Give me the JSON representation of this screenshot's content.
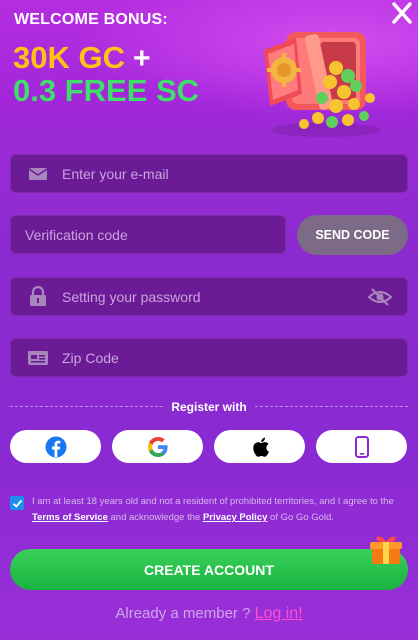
{
  "banner": {
    "welcome": "WELCOME BONUS:",
    "gc": "30K GC",
    "plus": "+",
    "sc": "0.3 FREE SC"
  },
  "form": {
    "email_placeholder": "Enter your e-mail",
    "code_placeholder": "Verification code",
    "send_code_label": "SEND CODE",
    "password_placeholder": "Setting your password",
    "zip_placeholder": "Zip Code"
  },
  "social": {
    "divider_label": "Register with",
    "providers": [
      "facebook",
      "google",
      "apple",
      "phone"
    ]
  },
  "consent": {
    "text_1": "I am at least 18 years old and not a resident of prohibited territories, and I agree to the",
    "terms_link": "Terms of Service",
    "text_2": "and acknowledge the",
    "privacy_link": "Privacy Policy",
    "text_3": "of Go Go Gold.",
    "checked": true
  },
  "actions": {
    "create_account": "CREATE ACCOUNT",
    "already_member": "Already a member ?",
    "login": "Log in!"
  },
  "colors": {
    "gc": "#ffc21a",
    "sc": "#3ee06a",
    "create_button": "#17b43f",
    "login_link": "#ff4fd0"
  }
}
